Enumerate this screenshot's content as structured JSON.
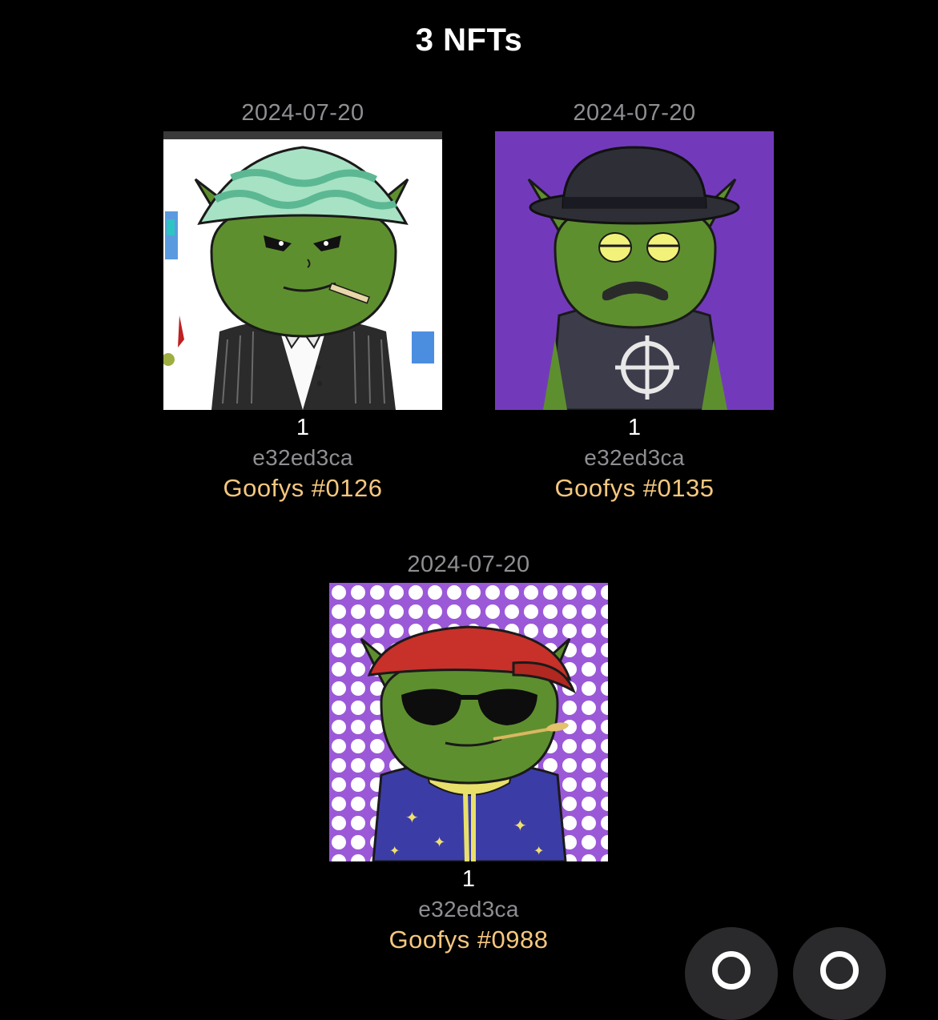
{
  "header": {
    "title": "3 NFTs"
  },
  "nfts": [
    {
      "date": "2024-07-20",
      "quantity": "1",
      "policy": "e32ed3ca",
      "name": "Goofys #0126",
      "background": "#ffffff"
    },
    {
      "date": "2024-07-20",
      "quantity": "1",
      "policy": "e32ed3ca",
      "name": "Goofys #0135",
      "background": "#7a3fc4"
    },
    {
      "date": "2024-07-20",
      "quantity": "1",
      "policy": "e32ed3ca",
      "name": "Goofys #0988",
      "background": "#9b59d8"
    }
  ],
  "floating_buttons": [
    {
      "icon": "refresh-icon"
    },
    {
      "icon": "search-icon"
    }
  ],
  "colors": {
    "background": "#000000",
    "title": "#ffffff",
    "date": "#8e8e93",
    "policy": "#8e8e93",
    "name": "#f5c77e",
    "goblin_skin": "#5e8f2f"
  }
}
